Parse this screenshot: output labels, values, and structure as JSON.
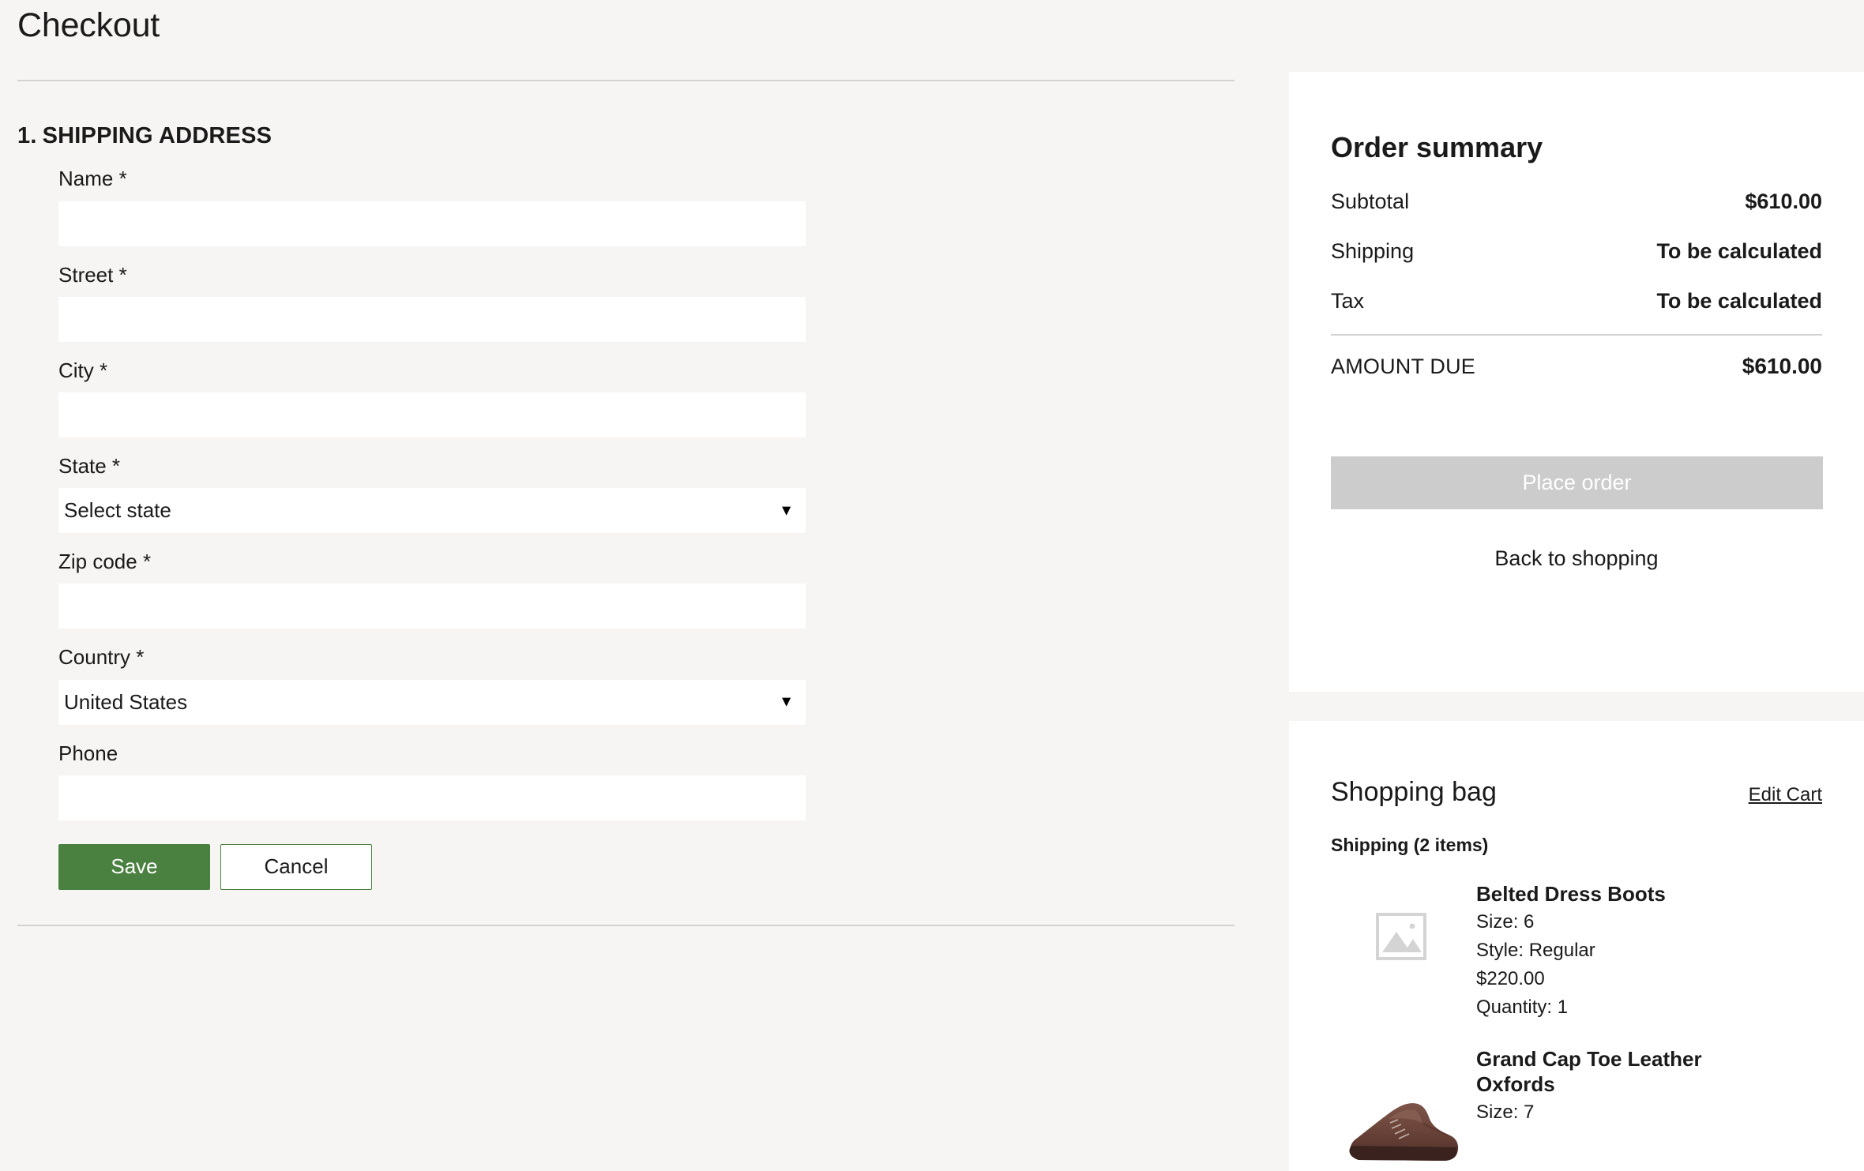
{
  "header": {
    "title": "Checkout"
  },
  "shipping_section": {
    "step_number": "1.",
    "heading": "SHIPPING ADDRESS",
    "fields": [
      {
        "label": "Name *",
        "type": "text",
        "value": "",
        "placeholder": ""
      },
      {
        "label": "Street *",
        "type": "text",
        "value": "",
        "placeholder": ""
      },
      {
        "label": "City *",
        "type": "text",
        "value": "",
        "placeholder": ""
      },
      {
        "label": "State *",
        "type": "select",
        "value": "Select state",
        "placeholder": ""
      },
      {
        "label": "Zip code *",
        "type": "text",
        "value": "",
        "placeholder": ""
      },
      {
        "label": "Country *",
        "type": "select",
        "value": "United States",
        "placeholder": ""
      },
      {
        "label": "Phone",
        "type": "text",
        "value": "",
        "placeholder": ""
      }
    ],
    "save_label": "Save",
    "cancel_label": "Cancel"
  },
  "order_summary": {
    "title": "Order summary",
    "rows": [
      {
        "label": "Subtotal",
        "value": "$610.00"
      },
      {
        "label": "Shipping",
        "value": "To be calculated"
      },
      {
        "label": "Tax",
        "value": "To be calculated"
      }
    ],
    "total_label": "AMOUNT DUE",
    "total_value": "$610.00",
    "place_order_label": "Place order",
    "place_order_disabled": true,
    "back_link_label": "Back to shopping"
  },
  "shopping_bag": {
    "title": "Shopping bag",
    "edit_cart_label": "Edit Cart",
    "shipping_group_label": "Shipping (2 items)",
    "items": [
      {
        "name": "Belted Dress Boots",
        "size": "Size: 6",
        "style": "Style: Regular",
        "price": "$220.00",
        "quantity": "Quantity: 1",
        "thumb": "image-placeholder-icon"
      },
      {
        "name": "Grand Cap Toe Leather Oxfords",
        "size": "Size: 7",
        "style": "",
        "price": "",
        "quantity": "",
        "thumb": "brown-oxford-shoe-photo"
      }
    ]
  },
  "colors": {
    "page_background": "#f6f5f3",
    "panel_background": "#ffffff",
    "accent_green": "#4a8040",
    "disabled_gray": "#cccccc",
    "divider": "#d2d2d2",
    "text": "#1a1a1a"
  }
}
